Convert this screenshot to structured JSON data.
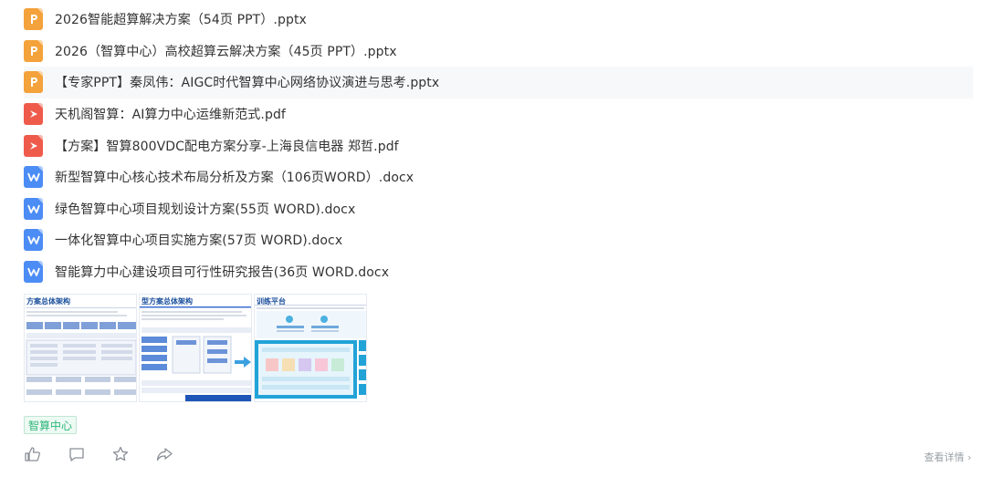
{
  "files": [
    {
      "type": "ppt",
      "icon": "ppt-icon",
      "name": "2026智能超算解决方案（54页 PPT）.pptx"
    },
    {
      "type": "ppt",
      "icon": "ppt-icon",
      "name": "2026（智算中心）高校超算云解决方案（45页 PPT）.pptx"
    },
    {
      "type": "ppt",
      "icon": "ppt-icon",
      "name": "【专家PPT】秦凤伟：AIGC时代智算中心网络协议演进与思考.pptx"
    },
    {
      "type": "pdf",
      "icon": "pdf-icon",
      "name": "天机阁智算：AI算力中心运维新范式.pdf"
    },
    {
      "type": "pdf",
      "icon": "pdf-icon",
      "name": "【方案】智算800VDC配电方案分享-上海良信电器 郑哲.pdf"
    },
    {
      "type": "word",
      "icon": "word-icon",
      "name": "新型智算中心核心技术布局分析及方案（106页WORD）.docx"
    },
    {
      "type": "word",
      "icon": "word-icon",
      "name": "绿色智算中心项目规划设计方案(55页 WORD).docx"
    },
    {
      "type": "word",
      "icon": "word-icon",
      "name": "一体化智算中心项目实施方案(57页 WORD).docx"
    },
    {
      "type": "word",
      "icon": "word-icon",
      "name": "智能算力中心建设项目可行性研究报告(36页 WORD.docx"
    }
  ],
  "thumbnails": [
    {
      "title": "方案总体架构"
    },
    {
      "title": "型方案总体架构"
    },
    {
      "title": "训练平台"
    }
  ],
  "tag": "智算中心",
  "actions": [
    "like-icon",
    "comment-icon",
    "star-icon",
    "share-icon"
  ],
  "more_link": "查看详情 ›",
  "colors": {
    "ppt": "#f4a23b",
    "pdf": "#ef5b4b",
    "word": "#4c8cf5",
    "tag": "#2fb67a"
  }
}
